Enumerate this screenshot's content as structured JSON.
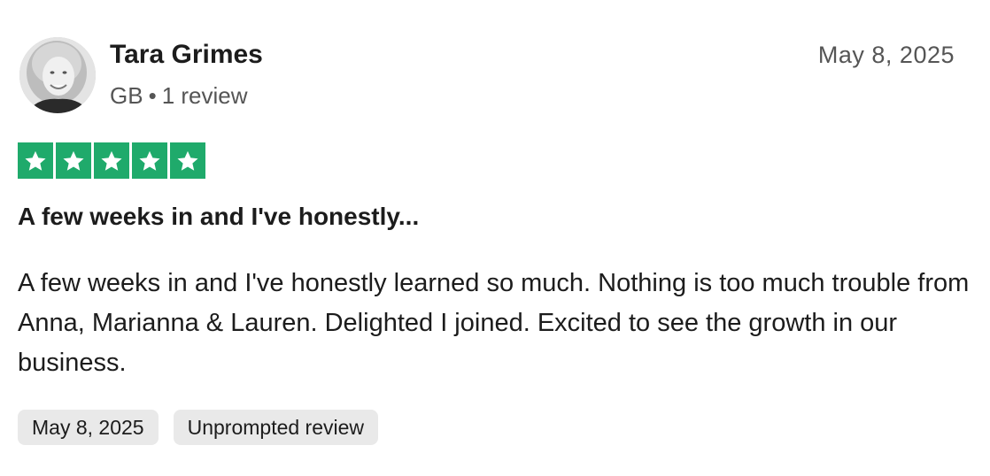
{
  "reviewer": {
    "name": "Tara Grimes",
    "country": "GB",
    "separator": "•",
    "review_count": "1 review"
  },
  "review": {
    "date": "May 8, 2025",
    "rating": 5,
    "rating_max": 5,
    "title": "A few weeks in and I've honestly...",
    "body": "A few weeks in and I've honestly learned so much. Nothing is too much trouble from Anna, Marianna & Lauren. Delighted I joined. Excited to see the growth in our business."
  },
  "tags": {
    "date_tag": "May 8, 2025",
    "source_tag": "Unprompted review"
  },
  "colors": {
    "star_green": "#1faa6b",
    "tag_bg": "#e9e9e9",
    "meta_gray": "#555555"
  },
  "icons": {
    "star": "star-icon",
    "avatar": "avatar"
  }
}
